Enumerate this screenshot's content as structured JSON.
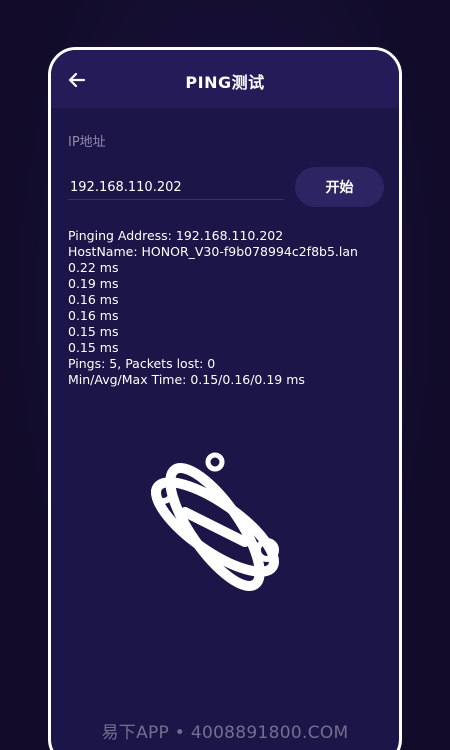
{
  "header": {
    "title": "PING测试",
    "back_icon": "arrow-left-icon"
  },
  "form": {
    "ip_label": "IP地址",
    "ip_value": "192.168.110.202",
    "start_label": "开始"
  },
  "output": {
    "lines": [
      "Pinging Address: 192.168.110.202",
      "HostName: HONOR_V30-f9b078994c2f8b5.lan",
      "0.22 ms",
      "0.19 ms",
      "0.16 ms",
      "0.16 ms",
      "0.15 ms",
      "0.15 ms",
      "Pings: 5, Packets lost: 0",
      "Min/Avg/Max Time: 0.15/0.16/0.19 ms"
    ]
  },
  "illustration": {
    "icon": "atom-icon"
  },
  "watermark": {
    "text": "易下APP • 4008891800.COM"
  },
  "colors": {
    "background": "#120c2a",
    "card": "#1c1548",
    "header": "#241b58",
    "button": "#2c2463",
    "text": "#ffffff",
    "muted": "#8f8aa8"
  }
}
